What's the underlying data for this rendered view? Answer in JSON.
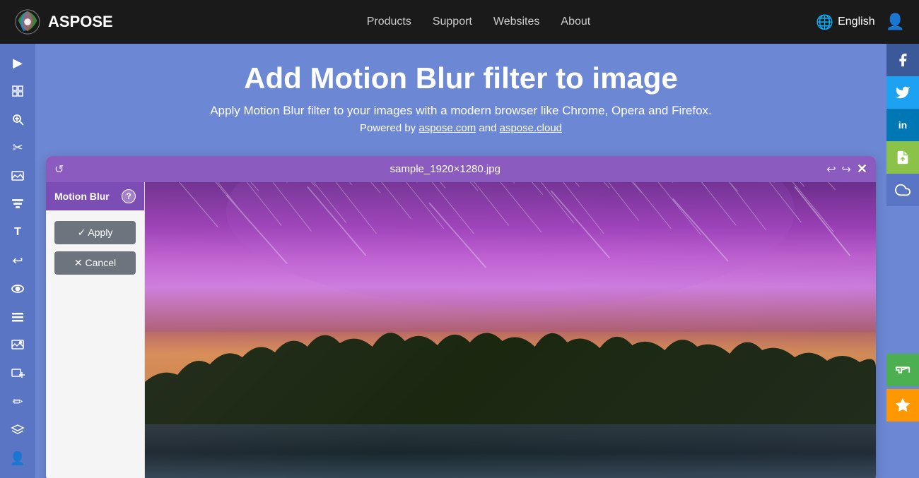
{
  "brand": {
    "name": "ASPOSE",
    "logo_alt": "Aspose Logo"
  },
  "navbar": {
    "links": [
      {
        "id": "products",
        "label": "Products"
      },
      {
        "id": "support",
        "label": "Support"
      },
      {
        "id": "websites",
        "label": "Websites"
      },
      {
        "id": "about",
        "label": "About"
      }
    ],
    "language": "English",
    "language_icon": "🌐"
  },
  "hero": {
    "title": "Add Motion Blur filter to image",
    "subtitle": "Apply Motion Blur filter to your images with a modern browser like Chrome, Opera and Firefox.",
    "powered_by": "Powered by",
    "powered_link1": "aspose.com",
    "powered_link2": "aspose.cloud",
    "powered_and": "and"
  },
  "editor": {
    "filename": "sample_1920×1280.jpg",
    "filter_label": "Motion Blur",
    "help_label": "?",
    "apply_label": "✓ Apply",
    "cancel_label": "✕ Cancel"
  },
  "sidebar": {
    "tools": [
      {
        "id": "arrow-right",
        "icon": "▶",
        "title": "Next"
      },
      {
        "id": "transform",
        "icon": "⊞",
        "title": "Transform"
      },
      {
        "id": "zoom",
        "icon": "🔍",
        "title": "Zoom"
      },
      {
        "id": "crop",
        "icon": "✂",
        "title": "Crop"
      },
      {
        "id": "landscape",
        "icon": "🏔",
        "title": "Landscape"
      },
      {
        "id": "filter",
        "icon": "▦",
        "title": "Filter"
      },
      {
        "id": "text",
        "icon": "T",
        "title": "Text"
      },
      {
        "id": "undo",
        "icon": "↩",
        "title": "Undo"
      },
      {
        "id": "eye",
        "icon": "👁",
        "title": "Preview"
      },
      {
        "id": "list",
        "icon": "☰",
        "title": "List"
      },
      {
        "id": "image-edit",
        "icon": "🖼",
        "title": "Edit Image"
      },
      {
        "id": "add-image",
        "icon": "⊕",
        "title": "Add Image"
      },
      {
        "id": "brush",
        "icon": "✏",
        "title": "Brush"
      },
      {
        "id": "layers",
        "icon": "◫",
        "title": "Layers"
      },
      {
        "id": "person",
        "icon": "👤",
        "title": "Person"
      }
    ]
  },
  "social": {
    "facebook": {
      "icon": "f",
      "color": "#3b5998"
    },
    "twitter": {
      "icon": "🐦",
      "color": "#1da1f2"
    },
    "linkedin": {
      "icon": "in",
      "color": "#0077b5"
    },
    "file_share": {
      "icon": "📄",
      "color": "#8bc34a"
    },
    "cloud": {
      "icon": "☁",
      "color": "#5a75c4"
    }
  },
  "action_btns": {
    "announce": "📢",
    "star": "⭐"
  }
}
